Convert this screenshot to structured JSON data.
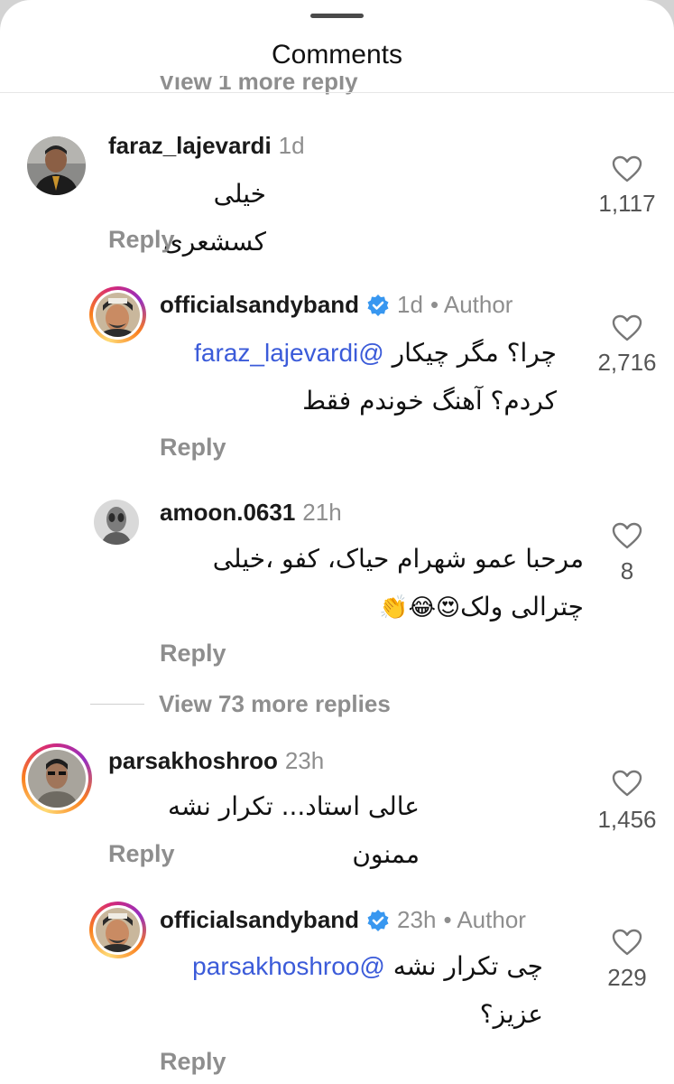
{
  "sheet": {
    "title": "Comments",
    "clipped_reply_text": "View 1 more reply"
  },
  "comments": [
    {
      "username": "faraz_lajevardi",
      "time": "1d",
      "text": "خیلی کسشعری",
      "reply_label": "Reply",
      "likes": "1,117"
    },
    {
      "username": "officialsandyband",
      "time": "1d",
      "author_label": "• Author",
      "mention": "@faraz_lajevardi",
      "text_line1": "چرا؟ مگر چیکار",
      "text_line2": "کردم؟ آهنگ خوندم فقط",
      "reply_label": "Reply",
      "likes": "2,716"
    },
    {
      "username": "amoon.0631",
      "time": "21h",
      "text_line1": "مرحبا عمو شهرام حیاک، کفو ،خیلی",
      "text_line2": "چترالی ولک",
      "emojis": "😍😂👏",
      "reply_label": "Reply",
      "likes": "8"
    },
    {
      "username": "parsakhoshroo",
      "time": "23h",
      "text": "عالی استاد... تکرار نشه ممنون",
      "reply_label": "Reply",
      "likes": "1,456"
    },
    {
      "username": "officialsandyband",
      "time": "23h",
      "author_label": "• Author",
      "mention": "@parsakhoshroo",
      "text_line1": "چی تکرار نشه",
      "text_line2": "عزیز؟",
      "reply_label": "Reply",
      "likes": "229"
    }
  ],
  "view_more": {
    "label": "View 73 more replies"
  },
  "colors": {
    "mention": "#3b5bd9",
    "verified": "#3897f0",
    "secondary_text": "#8e8e8e"
  },
  "icons": [
    "heart-icon",
    "verified-badge-icon"
  ]
}
